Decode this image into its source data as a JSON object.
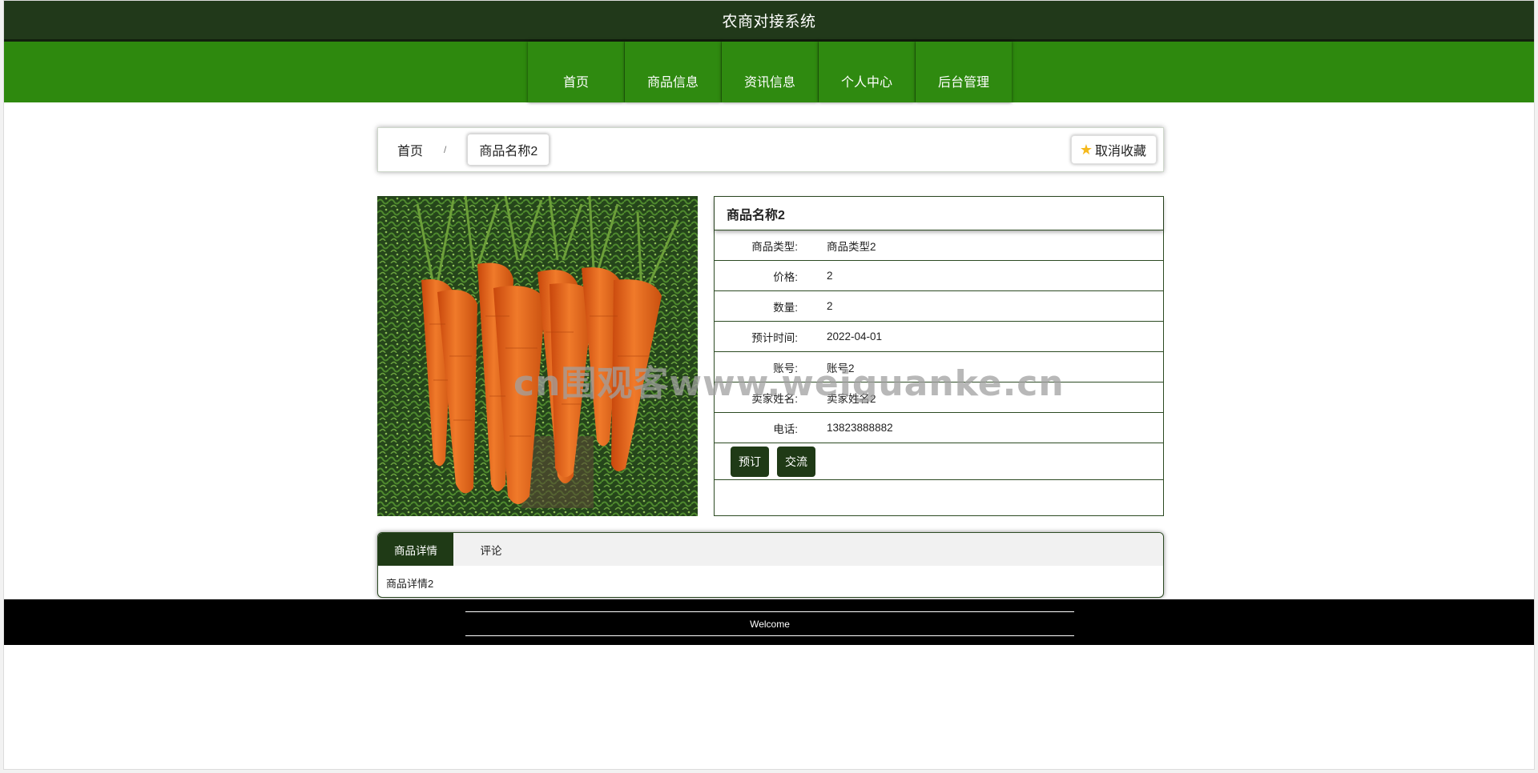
{
  "header": {
    "title": "农商对接系统"
  },
  "nav": {
    "items": [
      {
        "label": "首页"
      },
      {
        "label": "商品信息"
      },
      {
        "label": "资讯信息"
      },
      {
        "label": "个人中心"
      },
      {
        "label": "后台管理"
      }
    ]
  },
  "breadcrumb": {
    "home": "首页",
    "separator": "/",
    "current": "商品名称2"
  },
  "favorite_button": {
    "icon": "star-icon",
    "label": "取消收藏"
  },
  "product": {
    "image_alt": "carrots",
    "name": "商品名称2",
    "fields": [
      {
        "label": "商品类型:",
        "value": "商品类型2"
      },
      {
        "label": "价格:",
        "value": "2"
      },
      {
        "label": "数量:",
        "value": "2"
      },
      {
        "label": "预计时间:",
        "value": "2022-04-01"
      },
      {
        "label": "账号:",
        "value": "账号2"
      },
      {
        "label": "卖家姓名:",
        "value": "卖家姓名2"
      },
      {
        "label": "电话:",
        "value": "13823888882"
      }
    ],
    "actions": {
      "reserve": "预订",
      "chat": "交流"
    }
  },
  "tabs": {
    "items": [
      {
        "label": "商品详情"
      },
      {
        "label": "评论"
      }
    ],
    "active_content": "商品详情2"
  },
  "footer": {
    "text": "Welcome"
  },
  "watermark": "cn围观客www.weiguanke.cn",
  "colors": {
    "header_bg": "#21391a",
    "nav_bg": "#2e890e",
    "button_bg": "#1f3a16",
    "footer_bg": "#000000",
    "star": "#f5b91c"
  }
}
